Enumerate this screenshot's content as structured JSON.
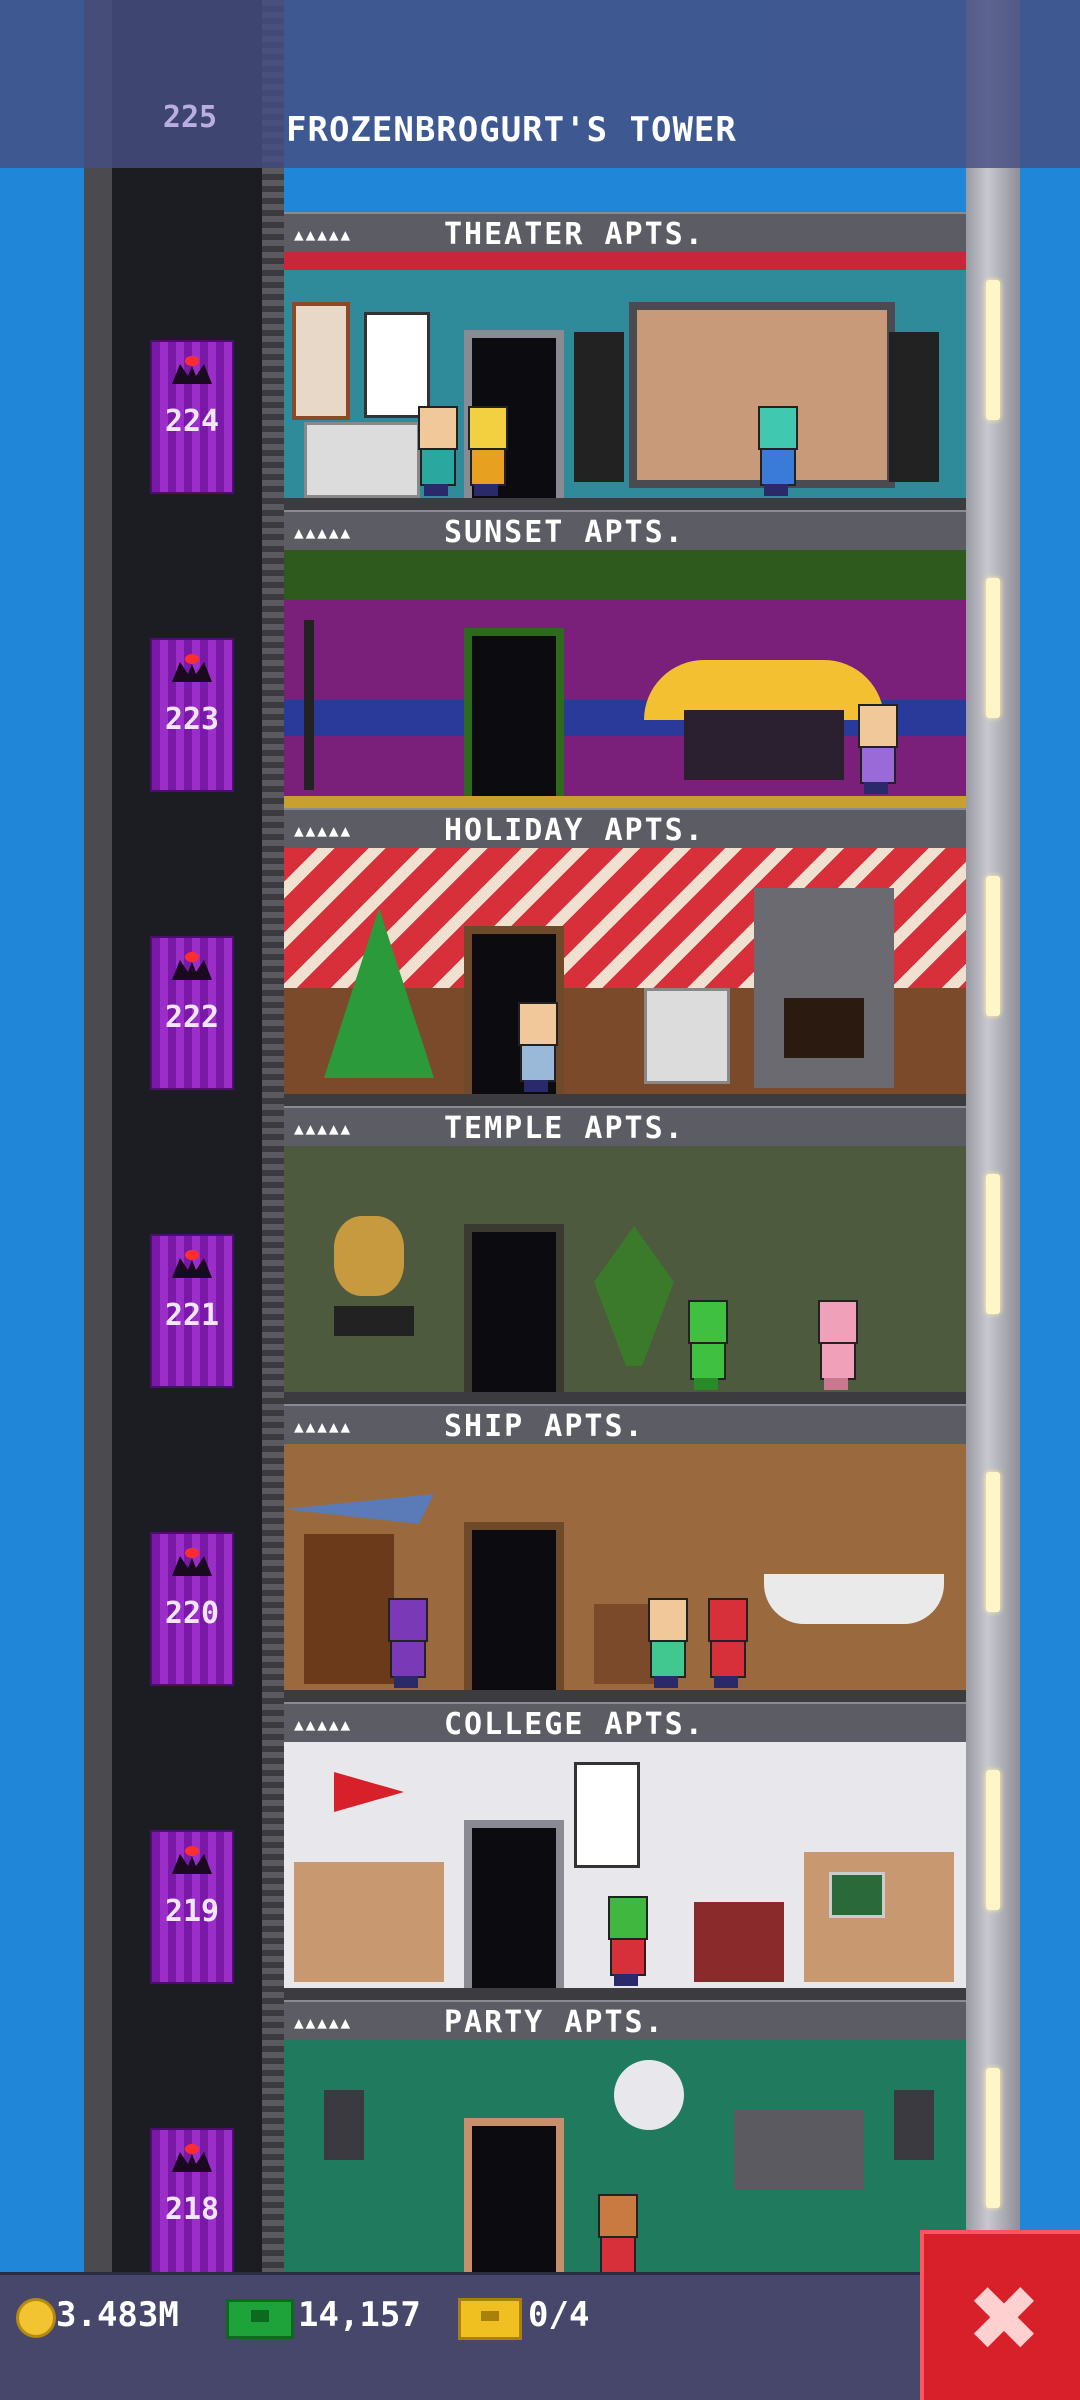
{
  "tower": {
    "title": "FROZENBROGURT'S TOWER",
    "top_floor_number": "225"
  },
  "floors": [
    {
      "number": "224",
      "stars": "▲▲▲▲▲",
      "name": "THEATER APTS.",
      "bg": "#2f8a9a"
    },
    {
      "number": "223",
      "stars": "▲▲▲▲▲",
      "name": "SUNSET APTS.",
      "bg": "#7a1f7a"
    },
    {
      "number": "222",
      "stars": "▲▲▲▲▲",
      "name": "HOLIDAY APTS.",
      "bg": "#c8343a"
    },
    {
      "number": "221",
      "stars": "▲▲▲▲▲",
      "name": "TEMPLE APTS.",
      "bg": "#4e5a3e"
    },
    {
      "number": "220",
      "stars": "▲▲▲▲▲",
      "name": "SHIP APTS.",
      "bg": "#9a6a3e"
    },
    {
      "number": "219",
      "stars": "▲▲▲▲▲",
      "name": "COLLEGE APTS.",
      "bg": "#e8e8ec"
    },
    {
      "number": "218",
      "stars": "▲▲▲▲▲",
      "name": "PARTY APTS.",
      "bg": "#1f7a5e"
    }
  ],
  "stats": {
    "coins": "3.483M",
    "bux": "14,157",
    "tickets": "0/4"
  },
  "colors": {
    "sky": "#1f86d8",
    "elevator": "#9b2ec9",
    "close_button": "#d8202a"
  },
  "icons": {
    "coin": "coin-icon",
    "bux": "bux-icon",
    "ticket": "ticket-icon",
    "close": "close-icon"
  }
}
